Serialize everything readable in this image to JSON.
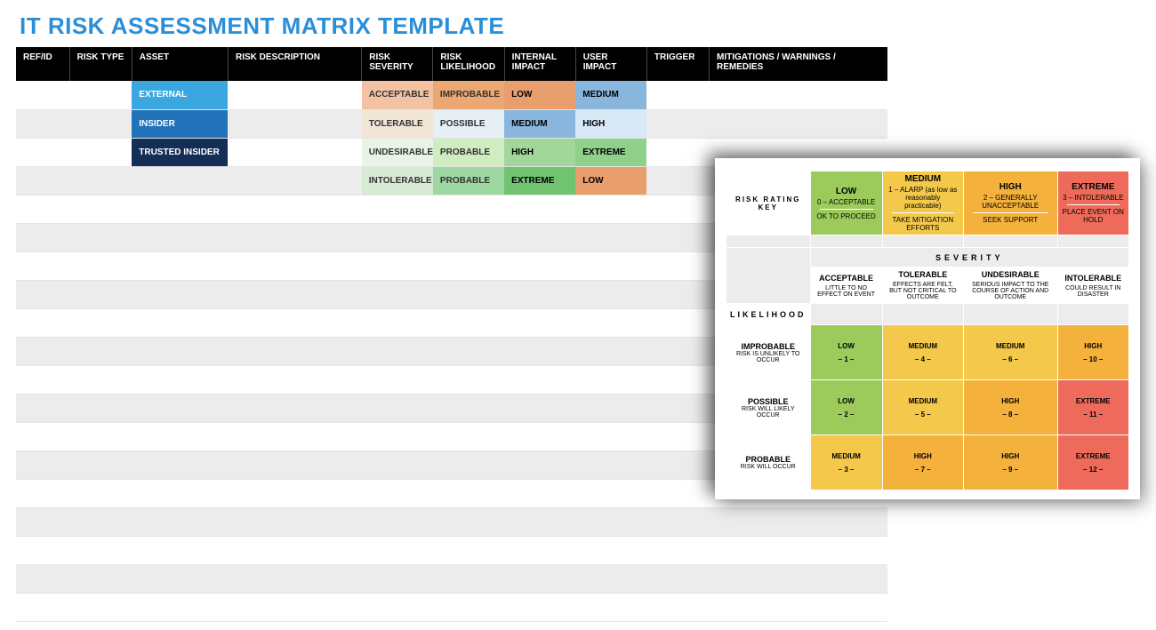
{
  "title": "IT RISK ASSESSMENT MATRIX TEMPLATE",
  "columns": [
    "REF/ID",
    "RISK TYPE",
    "ASSET",
    "RISK DESCRIPTION",
    "RISK SEVERITY",
    "RISK LIKELIHOOD",
    "INTERNAL IMPACT",
    "USER IMPACT",
    "TRIGGER",
    "MITIGATIONS / WARNINGS / REMEDIES"
  ],
  "rows": {
    "r1": {
      "asset": "EXTERNAL",
      "severity": "ACCEPTABLE",
      "likelihood": "IMPROBABLE",
      "internal": "LOW",
      "user": "MEDIUM"
    },
    "r2": {
      "asset": "INSIDER",
      "severity": "TOLERABLE",
      "likelihood": "POSSIBLE",
      "internal": "MEDIUM",
      "user": "HIGH"
    },
    "r3": {
      "asset": "TRUSTED INSIDER",
      "severity": "UNDESIRABLE",
      "likelihood": "PROBABLE",
      "internal": "HIGH",
      "user": "EXTREME"
    },
    "r4": {
      "asset": "",
      "severity": "INTOLERABLE",
      "likelihood": "PROBABLE",
      "internal": "EXTREME",
      "user": "LOW"
    }
  },
  "key": {
    "title": "RISK RATING KEY",
    "levels": [
      {
        "name": "LOW",
        "score": "0 – ACCEPTABLE",
        "action": "OK TO PROCEED"
      },
      {
        "name": "MEDIUM",
        "score": "1 – ALARP (as low as reasonably practicable)",
        "action": "TAKE MITIGATION EFFORTS"
      },
      {
        "name": "HIGH",
        "score": "2 – GENERALLY UNACCEPTABLE",
        "action": "SEEK SUPPORT"
      },
      {
        "name": "EXTREME",
        "score": "3 – INTOLERABLE",
        "action": "PLACE EVENT ON HOLD"
      }
    ],
    "severity_label": "SEVERITY",
    "likelihood_label": "LIKELIHOOD",
    "severity_cols": [
      {
        "name": "ACCEPTABLE",
        "desc": "LITTLE TO NO EFFECT ON EVENT"
      },
      {
        "name": "TOLERABLE",
        "desc": "EFFECTS ARE FELT, BUT NOT CRITICAL TO OUTCOME"
      },
      {
        "name": "UNDESIRABLE",
        "desc": "SERIOUS IMPACT TO THE COURSE OF ACTION AND OUTCOME"
      },
      {
        "name": "INTOLERABLE",
        "desc": "COULD RESULT IN DISASTER"
      }
    ],
    "likelihood_rows": [
      {
        "name": "IMPROBABLE",
        "desc": "RISK IS UNLIKELY TO OCCUR"
      },
      {
        "name": "POSSIBLE",
        "desc": "RISK WILL LIKELY OCCUR"
      },
      {
        "name": "PROBABLE",
        "desc": "RISK WILL OCCUR"
      }
    ],
    "matrix": [
      [
        {
          "label": "LOW",
          "n": "– 1 –",
          "c": "lv-low"
        },
        {
          "label": "MEDIUM",
          "n": "– 4 –",
          "c": "lv-med"
        },
        {
          "label": "MEDIUM",
          "n": "– 6 –",
          "c": "lv-med"
        },
        {
          "label": "HIGH",
          "n": "– 10 –",
          "c": "lv-high"
        }
      ],
      [
        {
          "label": "LOW",
          "n": "– 2 –",
          "c": "lv-low"
        },
        {
          "label": "MEDIUM",
          "n": "– 5 –",
          "c": "lv-med"
        },
        {
          "label": "HIGH",
          "n": "– 8 –",
          "c": "lv-high"
        },
        {
          "label": "EXTREME",
          "n": "– 11 –",
          "c": "lv-ext"
        }
      ],
      [
        {
          "label": "MEDIUM",
          "n": "– 3 –",
          "c": "lv-med"
        },
        {
          "label": "HIGH",
          "n": "– 7 –",
          "c": "lv-high"
        },
        {
          "label": "HIGH",
          "n": "– 9 –",
          "c": "lv-high"
        },
        {
          "label": "EXTREME",
          "n": "– 12 –",
          "c": "lv-ext"
        }
      ]
    ]
  }
}
